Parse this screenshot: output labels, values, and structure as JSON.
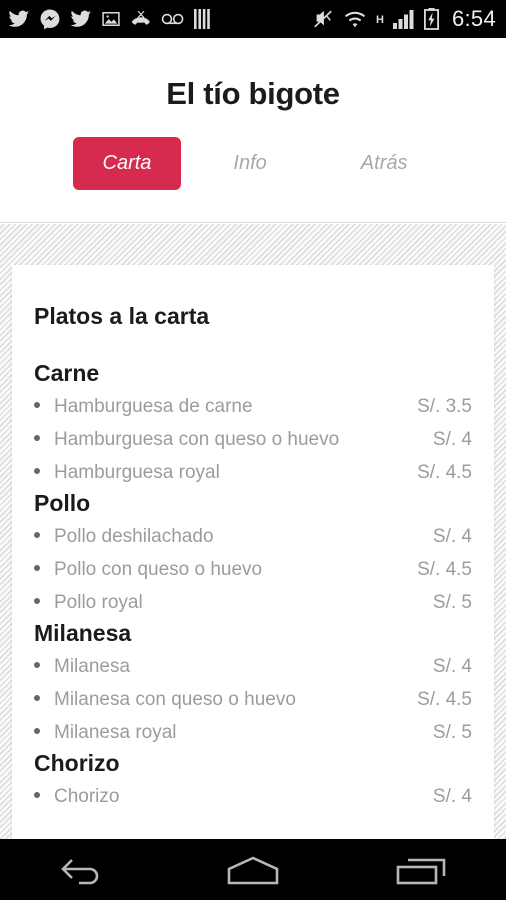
{
  "statusbar": {
    "left_icons": [
      {
        "name": "twitter-icon"
      },
      {
        "name": "facebook-messenger-icon"
      },
      {
        "name": "twitter-icon"
      },
      {
        "name": "photo-image-icon"
      },
      {
        "name": "missed-call-icon"
      },
      {
        "name": "voicemail-icon"
      },
      {
        "name": "equalizer-bars-icon"
      }
    ],
    "right_icons": [
      {
        "name": "vibrate-off-icon"
      },
      {
        "name": "wifi-icon"
      },
      {
        "name": "network-type-hspa-label",
        "label": "H"
      },
      {
        "name": "cellular-signal-icon"
      },
      {
        "name": "battery-charging-icon"
      }
    ],
    "clock": "6:54"
  },
  "header": {
    "title": "El tío bigote",
    "tabs": [
      {
        "label": "Carta",
        "active": true
      },
      {
        "label": "Info",
        "active": false
      },
      {
        "label": "Atrás",
        "active": false
      }
    ]
  },
  "menu": {
    "title": "Platos a la carta",
    "sections": [
      {
        "name": "Carne",
        "items": [
          {
            "name": "Hamburguesa de carne",
            "price": "S/. 3.5"
          },
          {
            "name": "Hamburguesa con queso o huevo",
            "price": "S/. 4"
          },
          {
            "name": "Hamburguesa royal",
            "price": "S/. 4.5"
          }
        ]
      },
      {
        "name": "Pollo",
        "items": [
          {
            "name": "Pollo deshilachado",
            "price": "S/. 4"
          },
          {
            "name": "Pollo con queso o huevo",
            "price": "S/. 4.5"
          },
          {
            "name": "Pollo royal",
            "price": "S/. 5"
          }
        ]
      },
      {
        "name": "Milanesa",
        "items": [
          {
            "name": "Milanesa",
            "price": "S/. 4"
          },
          {
            "name": "Milanesa con queso o huevo",
            "price": "S/. 4.5"
          },
          {
            "name": "Milanesa royal",
            "price": "S/. 5"
          }
        ]
      },
      {
        "name": "Chorizo",
        "items": [
          {
            "name": "Chorizo",
            "price": "S/. 4"
          }
        ]
      }
    ]
  },
  "navbar": {
    "buttons": [
      {
        "name": "back-button"
      },
      {
        "name": "home-button"
      },
      {
        "name": "recents-button"
      }
    ]
  },
  "colors": {
    "accent": "#d62a4e",
    "text_dark": "#1b1b1b",
    "text_muted": "#9c9c9c",
    "bg_texture": "#eceded"
  }
}
